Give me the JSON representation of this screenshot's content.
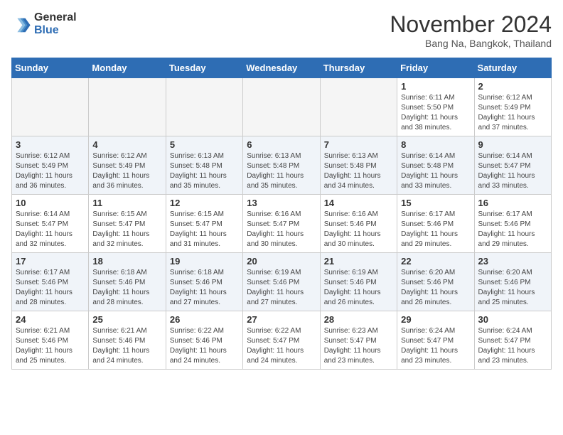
{
  "logo": {
    "general": "General",
    "blue": "Blue"
  },
  "title": "November 2024",
  "location": "Bang Na, Bangkok, Thailand",
  "weekdays": [
    "Sunday",
    "Monday",
    "Tuesday",
    "Wednesday",
    "Thursday",
    "Friday",
    "Saturday"
  ],
  "rows": [
    {
      "cells": [
        {
          "empty": true
        },
        {
          "empty": true
        },
        {
          "empty": true
        },
        {
          "empty": true
        },
        {
          "empty": true
        },
        {
          "day": "1",
          "sunrise": "6:11 AM",
          "sunset": "5:50 PM",
          "daylight": "11 hours and 38 minutes."
        },
        {
          "day": "2",
          "sunrise": "6:12 AM",
          "sunset": "5:49 PM",
          "daylight": "11 hours and 37 minutes."
        }
      ]
    },
    {
      "alt": true,
      "cells": [
        {
          "day": "3",
          "sunrise": "6:12 AM",
          "sunset": "5:49 PM",
          "daylight": "11 hours and 36 minutes."
        },
        {
          "day": "4",
          "sunrise": "6:12 AM",
          "sunset": "5:49 PM",
          "daylight": "11 hours and 36 minutes."
        },
        {
          "day": "5",
          "sunrise": "6:13 AM",
          "sunset": "5:48 PM",
          "daylight": "11 hours and 35 minutes."
        },
        {
          "day": "6",
          "sunrise": "6:13 AM",
          "sunset": "5:48 PM",
          "daylight": "11 hours and 35 minutes."
        },
        {
          "day": "7",
          "sunrise": "6:13 AM",
          "sunset": "5:48 PM",
          "daylight": "11 hours and 34 minutes."
        },
        {
          "day": "8",
          "sunrise": "6:14 AM",
          "sunset": "5:48 PM",
          "daylight": "11 hours and 33 minutes."
        },
        {
          "day": "9",
          "sunrise": "6:14 AM",
          "sunset": "5:47 PM",
          "daylight": "11 hours and 33 minutes."
        }
      ]
    },
    {
      "cells": [
        {
          "day": "10",
          "sunrise": "6:14 AM",
          "sunset": "5:47 PM",
          "daylight": "11 hours and 32 minutes."
        },
        {
          "day": "11",
          "sunrise": "6:15 AM",
          "sunset": "5:47 PM",
          "daylight": "11 hours and 32 minutes."
        },
        {
          "day": "12",
          "sunrise": "6:15 AM",
          "sunset": "5:47 PM",
          "daylight": "11 hours and 31 minutes."
        },
        {
          "day": "13",
          "sunrise": "6:16 AM",
          "sunset": "5:47 PM",
          "daylight": "11 hours and 30 minutes."
        },
        {
          "day": "14",
          "sunrise": "6:16 AM",
          "sunset": "5:46 PM",
          "daylight": "11 hours and 30 minutes."
        },
        {
          "day": "15",
          "sunrise": "6:17 AM",
          "sunset": "5:46 PM",
          "daylight": "11 hours and 29 minutes."
        },
        {
          "day": "16",
          "sunrise": "6:17 AM",
          "sunset": "5:46 PM",
          "daylight": "11 hours and 29 minutes."
        }
      ]
    },
    {
      "alt": true,
      "cells": [
        {
          "day": "17",
          "sunrise": "6:17 AM",
          "sunset": "5:46 PM",
          "daylight": "11 hours and 28 minutes."
        },
        {
          "day": "18",
          "sunrise": "6:18 AM",
          "sunset": "5:46 PM",
          "daylight": "11 hours and 28 minutes."
        },
        {
          "day": "19",
          "sunrise": "6:18 AM",
          "sunset": "5:46 PM",
          "daylight": "11 hours and 27 minutes."
        },
        {
          "day": "20",
          "sunrise": "6:19 AM",
          "sunset": "5:46 PM",
          "daylight": "11 hours and 27 minutes."
        },
        {
          "day": "21",
          "sunrise": "6:19 AM",
          "sunset": "5:46 PM",
          "daylight": "11 hours and 26 minutes."
        },
        {
          "day": "22",
          "sunrise": "6:20 AM",
          "sunset": "5:46 PM",
          "daylight": "11 hours and 26 minutes."
        },
        {
          "day": "23",
          "sunrise": "6:20 AM",
          "sunset": "5:46 PM",
          "daylight": "11 hours and 25 minutes."
        }
      ]
    },
    {
      "cells": [
        {
          "day": "24",
          "sunrise": "6:21 AM",
          "sunset": "5:46 PM",
          "daylight": "11 hours and 25 minutes."
        },
        {
          "day": "25",
          "sunrise": "6:21 AM",
          "sunset": "5:46 PM",
          "daylight": "11 hours and 24 minutes."
        },
        {
          "day": "26",
          "sunrise": "6:22 AM",
          "sunset": "5:46 PM",
          "daylight": "11 hours and 24 minutes."
        },
        {
          "day": "27",
          "sunrise": "6:22 AM",
          "sunset": "5:47 PM",
          "daylight": "11 hours and 24 minutes."
        },
        {
          "day": "28",
          "sunrise": "6:23 AM",
          "sunset": "5:47 PM",
          "daylight": "11 hours and 23 minutes."
        },
        {
          "day": "29",
          "sunrise": "6:24 AM",
          "sunset": "5:47 PM",
          "daylight": "11 hours and 23 minutes."
        },
        {
          "day": "30",
          "sunrise": "6:24 AM",
          "sunset": "5:47 PM",
          "daylight": "11 hours and 23 minutes."
        }
      ]
    }
  ]
}
